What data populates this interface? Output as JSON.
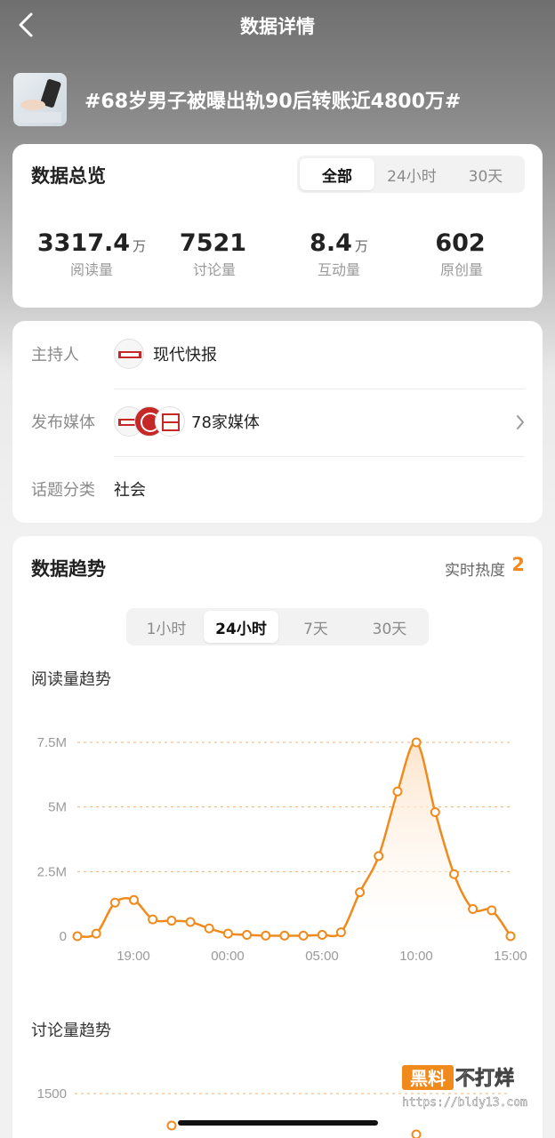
{
  "nav": {
    "title": "数据详情",
    "back_icon": "chevron-left-icon"
  },
  "topic": {
    "title": "#68岁男子被曝出轨90后转账近4800万#"
  },
  "overview": {
    "title": "数据总览",
    "tabs": [
      "全部",
      "24小时",
      "30天"
    ],
    "active_tab": "全部",
    "stats": [
      {
        "value": "3317.4",
        "unit": "万",
        "label": "阅读量"
      },
      {
        "value": "7521",
        "unit": "",
        "label": "讨论量"
      },
      {
        "value": "8.4",
        "unit": "万",
        "label": "互动量"
      },
      {
        "value": "602",
        "unit": "",
        "label": "原创量"
      }
    ]
  },
  "info": {
    "host": {
      "label": "主持人",
      "value": "现代快报"
    },
    "media": {
      "label": "发布媒体",
      "value": "78家媒体"
    },
    "category": {
      "label": "话题分类",
      "value": "社会"
    }
  },
  "trend": {
    "title": "数据趋势",
    "heat_label": "实时热度",
    "heat_value": "2",
    "tabs": [
      "1小时",
      "24小时",
      "7天",
      "30天"
    ],
    "active_tab": "24小时",
    "read_title": "阅读量趋势",
    "discuss_title": "讨论量趋势",
    "discuss_first_tick": "1500"
  },
  "colors": {
    "accent": "#f08a1c",
    "fill": "#fde3c8"
  },
  "watermark": {
    "line1": "黑料",
    "line2": "不打烊",
    "url": "https://bldy13.com"
  },
  "chart_data": {
    "type": "area",
    "title": "阅读量趋势",
    "x_tick_labels": [
      "19:00",
      "00:00",
      "05:00",
      "10:00",
      "15:00"
    ],
    "y_tick_labels": [
      "0",
      "2.5M",
      "5M",
      "7.5M"
    ],
    "ylim": [
      0,
      7.5
    ],
    "y_unit": "M",
    "grid": true,
    "series": [
      {
        "values": [
          0.0,
          0.1,
          1.3,
          1.4,
          0.65,
          0.6,
          0.55,
          0.3,
          0.1,
          0.05,
          0.02,
          0.02,
          0.02,
          0.05,
          0.15,
          1.7,
          3.1,
          5.6,
          7.5,
          4.8,
          2.4,
          1.05,
          1.0,
          0.0
        ]
      }
    ]
  }
}
